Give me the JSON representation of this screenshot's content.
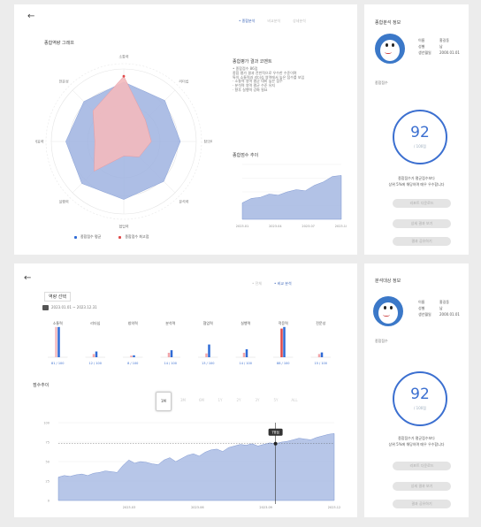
{
  "colors": {
    "accent": "#3b6fd0",
    "blue_fill": "#9fb3e0",
    "red_fill": "#f3b9bd",
    "red": "#e04a4a",
    "blue": "#2f6bd6"
  },
  "icons": {
    "back": "arrow-left-icon",
    "calendar": "calendar-icon"
  },
  "top": {
    "back_label": "←",
    "tabs": [
      "• 종합분석",
      "비교분석",
      "상세분석"
    ],
    "radar_title": "종합역량 그래프",
    "axis_labels": [
      "소통력",
      "리더십",
      "창의력",
      "분석력",
      "협업력",
      "실행력",
      "적응력",
      "전문성"
    ],
    "legend": [
      "종합점수 평균",
      "종합점수 최고점"
    ],
    "comment_title": "종합평가 결과 코멘트",
    "comment_lines": [
      "• 종합점수 86점",
      "종합 평가 결과 전반적으로 우수한 수준이며",
      "특히 소통력과 리더십 영역에서 높은 점수를 보임",
      "· 소통력 영역 평균 대비 높은 점수",
      "· 분석력 영역 평균 수준 유지",
      "· 향후 실행력 강화 필요"
    ],
    "trend_title": "종합점수 추이",
    "trend_xticks": [
      "2023.01",
      "2023.04",
      "2023.07",
      "2023.10"
    ]
  },
  "bottom": {
    "back_label": "←",
    "tabs": [
      "• 전체",
      "• 비교 분석"
    ],
    "selector_label": "역량 선택",
    "date_range": "2023.01.01 ~ 2023.12.31",
    "bar_groups": [
      "소통력",
      "리더십",
      "창의력",
      "분석력",
      "협업력",
      "실행력",
      "적응력",
      "전문성"
    ],
    "bar_captions": [
      "81 / 100",
      "12 / 100",
      "8 / 100",
      "14 / 100",
      "13 / 100",
      "14 / 100",
      "88 / 100",
      "15 / 100"
    ],
    "trend_title": "점수추이",
    "period_buttons": [
      "1M",
      "3M",
      "6M",
      "1Y",
      "2Y",
      "3Y",
      "5Y",
      "ALL"
    ],
    "tooltip": "78점",
    "trend_xticks": [
      "2023.03",
      "2023.06",
      "2023.09",
      "2023.12"
    ]
  },
  "profile": {
    "title_top": "종합분석 정보",
    "title_bottom": "분석대상 정보",
    "rows": [
      {
        "k": "이름",
        "v": "홍길동"
      },
      {
        "k": "성별",
        "v": "남"
      },
      {
        "k": "생년월일",
        "v": "2000.01.01"
      }
    ],
    "score_section": "종합점수",
    "score": "92",
    "score_unit": "/ 100점",
    "desc_line1": "종합점수가 평균점수보다",
    "desc_line2": "상위 5%에 해당하며 매우 우수합니다",
    "buttons": [
      "리포트 다운로드",
      "상세 결과 보기",
      "결과 공유하기"
    ]
  },
  "chart_data": [
    {
      "type": "radar",
      "categories": [
        "소통력",
        "리더십",
        "창의력",
        "분석력",
        "협업력",
        "실행력",
        "적응력",
        "전문성"
      ],
      "series": [
        {
          "name": "종합점수 평균",
          "values": [
            82,
            80,
            78,
            78,
            80,
            82,
            80,
            78
          ]
        },
        {
          "name": "종합점수 최고점",
          "values": [
            90,
            42,
            38,
            30,
            20,
            58,
            40,
            60
          ]
        }
      ],
      "ylim": [
        0,
        100
      ]
    },
    {
      "type": "area",
      "x": [
        "2023.01",
        "2023.02",
        "2023.03",
        "2023.04",
        "2023.05",
        "2023.06",
        "2023.07",
        "2023.08",
        "2023.09",
        "2023.10",
        "2023.11",
        "2023.12"
      ],
      "values": [
        30,
        38,
        40,
        46,
        44,
        50,
        54,
        52,
        62,
        68,
        78,
        80
      ],
      "ylim": [
        0,
        100
      ]
    },
    {
      "type": "bar",
      "categories": [
        "소통력",
        "리더십",
        "창의력",
        "분석력",
        "협업력",
        "실행력",
        "적응력",
        "전문성"
      ],
      "series": [
        {
          "values": [
            95,
            10,
            5,
            14,
            12,
            14,
            90,
            10
          ]
        },
        {
          "values": [
            95,
            18,
            6,
            22,
            40,
            25,
            95,
            15
          ]
        },
        {
          "values": [
            0,
            0,
            0,
            0,
            0,
            0,
            0,
            0
          ]
        }
      ],
      "ylim": [
        0,
        100
      ]
    },
    {
      "type": "area",
      "values": [
        30,
        32,
        31,
        33,
        34,
        32,
        35,
        36,
        38,
        37,
        36,
        45,
        52,
        48,
        50,
        49,
        47,
        46,
        52,
        55,
        50,
        54,
        58,
        60,
        57,
        62,
        65,
        66,
        63,
        68,
        70,
        72,
        71,
        73,
        70,
        72,
        74,
        73,
        75,
        76,
        78,
        80,
        79,
        78,
        81,
        83,
        85,
        86
      ],
      "ylim": [
        0,
        100
      ]
    }
  ]
}
